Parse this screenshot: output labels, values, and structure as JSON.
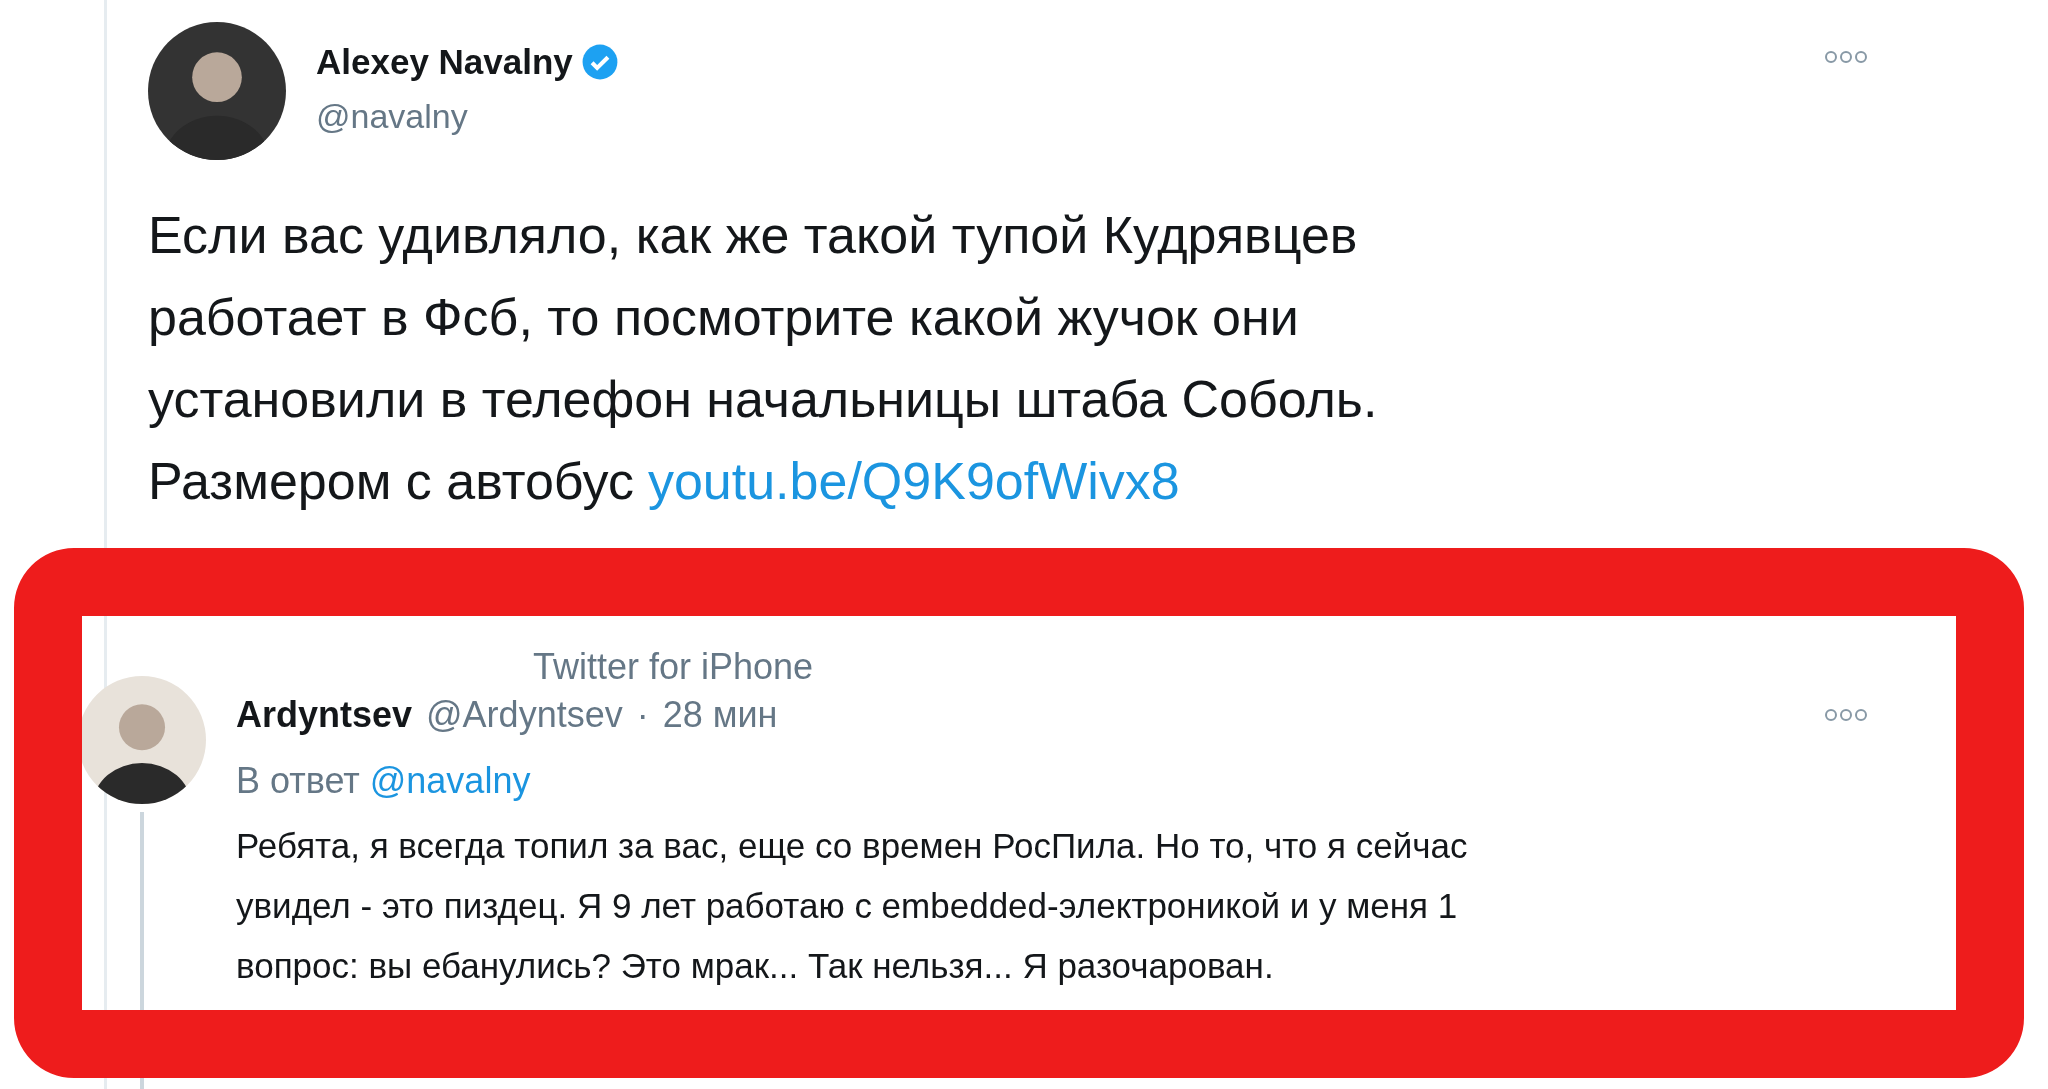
{
  "tweet": {
    "author": "Alexey Navalny",
    "verified": true,
    "handle": "@navalny",
    "text_lines": [
      "Если вас удивляло, как же такой тупой Кудрявцев",
      "работает в Фсб, то посмотрите какой жучок они",
      "установили в телефон начальницы штаба Соболь."
    ],
    "last_line": "Размером с автобус",
    "link": "youtu.be/Q9K9ofWivx8",
    "source": "Twitter for iPhone"
  },
  "reply": {
    "author": "Ardyntsev",
    "handle": "@Ardyntsev",
    "separator": "·",
    "time": "28 мин",
    "reply_to_label": "В ответ",
    "reply_to": "@navalny",
    "text_lines": [
      "Ребята, я всегда топил за вас, еще со времен РосПила. Но то, что я сейчас",
      "увидел - это пиздец. Я 9 лет работаю с embedded-электроникой и у меня 1",
      "вопрос: вы ебанулись? Это мрак... Так нельзя... Я разочарован."
    ]
  }
}
